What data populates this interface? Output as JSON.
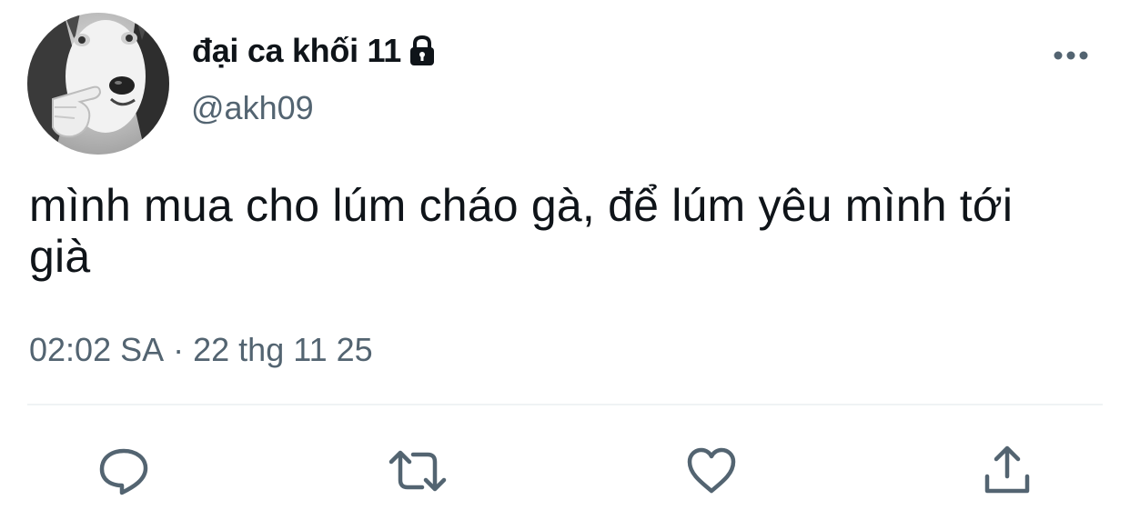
{
  "tweet": {
    "display_name": "đại ca khối 11",
    "handle": "@akh09",
    "protected": true,
    "text": "mình mua cho lúm cháo gà, để lúm yêu mình tới già",
    "time": "02:02 SA",
    "separator": "·",
    "date": "22 thg 11 25"
  },
  "icons": {
    "lock": "lock-icon",
    "more": "more-dots-icon",
    "reply": "reply-bubble-icon",
    "retweet": "retweet-icon",
    "like": "heart-icon",
    "share": "share-upload-icon"
  },
  "colors": {
    "text_primary": "#0f1419",
    "text_secondary": "#536471",
    "divider": "#eff3f4",
    "icon": "#536471"
  }
}
